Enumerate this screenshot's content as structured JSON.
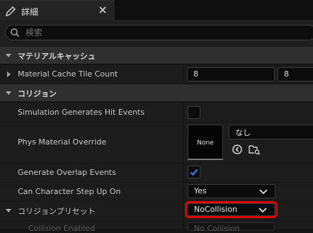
{
  "tab": {
    "title": "詳細"
  },
  "search": {
    "placeholder": "検索"
  },
  "categories": {
    "material_cache": "マテリアルキャッシュ",
    "collision": "コリジョン"
  },
  "properties": {
    "material_cache_tile_count": {
      "label": "Material Cache Tile Count",
      "values": [
        "8",
        "8"
      ]
    },
    "simulation_generates_hit_events": {
      "label": "Simulation Generates Hit Events",
      "checked": false
    },
    "phys_material_override": {
      "label": "Phys Material Override",
      "thumbnail": "None",
      "asset_value": "なし"
    },
    "generate_overlap_events": {
      "label": "Generate Overlap Events",
      "checked": true
    },
    "can_character_step_up_on": {
      "label": "Can Character Step Up On",
      "value": "Yes"
    },
    "collision_presets": {
      "label": "コリジョンプリセット",
      "value": "NoCollision"
    },
    "collision_enabled": {
      "label": "Collision Enabled",
      "value": "No Collision"
    }
  },
  "colors": {
    "panel_bg": "#1c1c1c",
    "category_bg": "#2f2f2f",
    "checkbox_accent": "#2f80e8",
    "highlight": "#e00000"
  },
  "icons": [
    "details-icon",
    "close-icon",
    "search-icon",
    "expand-arrow-icon",
    "browse-to-asset-icon",
    "use-selected-asset-icon",
    "chevron-down-icon"
  ]
}
